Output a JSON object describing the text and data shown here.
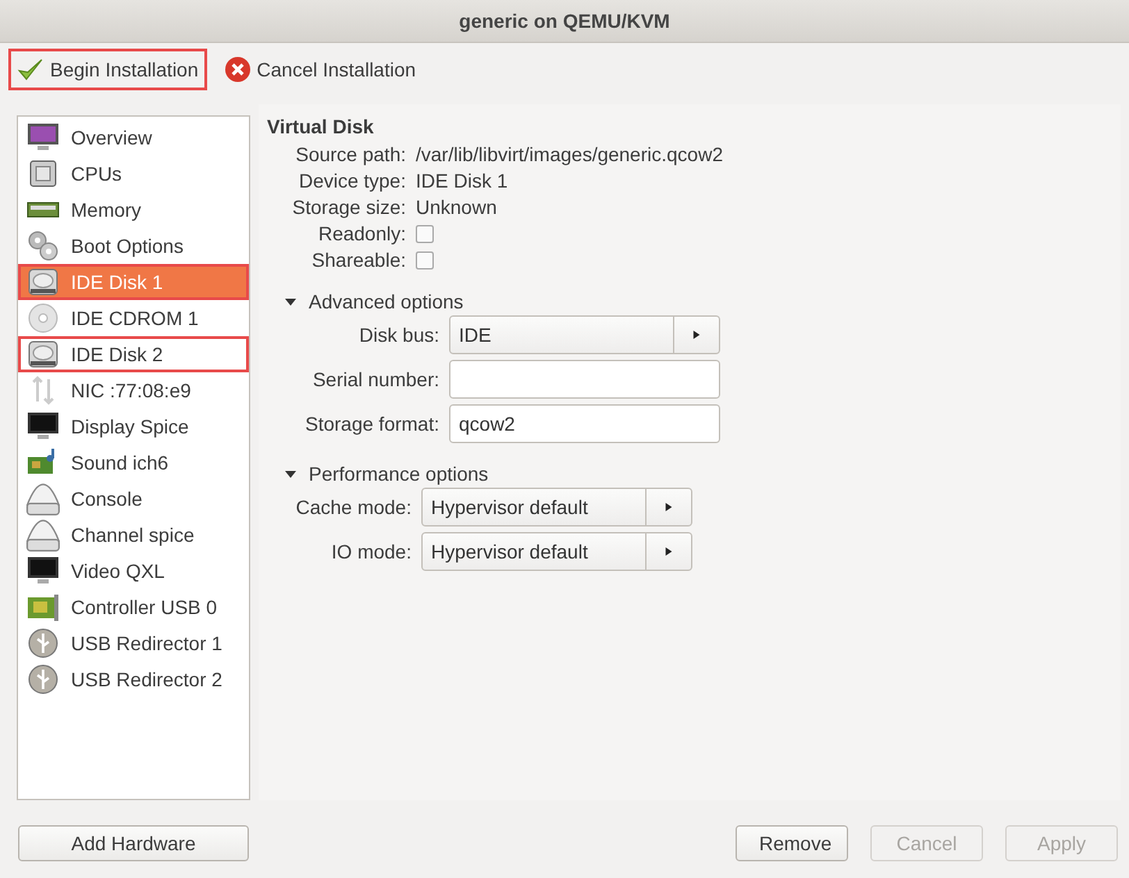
{
  "window": {
    "title": "generic on QEMU/KVM"
  },
  "toolbar": [
    {
      "label": "Begin Installation",
      "kind": "begin",
      "highlighted": true
    },
    {
      "label": "Cancel Installation",
      "kind": "cancel",
      "highlighted": false
    }
  ],
  "sidebar": {
    "items": [
      {
        "label": "Overview",
        "kind": "overview",
        "selected": false,
        "highlighted": false
      },
      {
        "label": "CPUs",
        "kind": "cpu",
        "selected": false,
        "highlighted": false
      },
      {
        "label": "Memory",
        "kind": "memory",
        "selected": false,
        "highlighted": false
      },
      {
        "label": "Boot Options",
        "kind": "boot",
        "selected": false,
        "highlighted": false
      },
      {
        "label": "IDE Disk 1",
        "kind": "disk",
        "selected": true,
        "highlighted": true
      },
      {
        "label": "IDE CDROM 1",
        "kind": "cdrom",
        "selected": false,
        "highlighted": false
      },
      {
        "label": "IDE Disk 2",
        "kind": "disk",
        "selected": false,
        "highlighted": true
      },
      {
        "label": "NIC :77:08:e9",
        "kind": "nic",
        "selected": false,
        "highlighted": false
      },
      {
        "label": "Display Spice",
        "kind": "display",
        "selected": false,
        "highlighted": false
      },
      {
        "label": "Sound ich6",
        "kind": "sound",
        "selected": false,
        "highlighted": false
      },
      {
        "label": "Console",
        "kind": "console",
        "selected": false,
        "highlighted": false
      },
      {
        "label": "Channel spice",
        "kind": "console",
        "selected": false,
        "highlighted": false
      },
      {
        "label": "Video QXL",
        "kind": "display",
        "selected": false,
        "highlighted": false
      },
      {
        "label": "Controller USB 0",
        "kind": "controller",
        "selected": false,
        "highlighted": false
      },
      {
        "label": "USB Redirector 1",
        "kind": "usb",
        "selected": false,
        "highlighted": false
      },
      {
        "label": "USB Redirector 2",
        "kind": "usb",
        "selected": false,
        "highlighted": false
      }
    ]
  },
  "details": {
    "title": "Virtual Disk",
    "info": [
      {
        "label": "Source path:",
        "value": "/var/lib/libvirt/images/generic.qcow2"
      },
      {
        "label": "Device type:",
        "value": "IDE Disk 1"
      },
      {
        "label": "Storage size:",
        "value": "Unknown"
      }
    ],
    "flags": [
      {
        "label": "Readonly:",
        "checked": false
      },
      {
        "label": "Shareable:",
        "checked": false
      }
    ],
    "sections": [
      {
        "title": "Advanced options",
        "expanded": true,
        "fields": [
          {
            "label": "Disk bus:",
            "kind": "combo",
            "value": "IDE"
          },
          {
            "label": "Serial number:",
            "kind": "entry"
          },
          {
            "label": "Storage format:",
            "kind": "entry",
            "value": "qcow2"
          }
        ]
      },
      {
        "title": "Performance options",
        "expanded": true,
        "fields": [
          {
            "label": "Cache mode:",
            "kind": "combo",
            "value": "Hypervisor default"
          },
          {
            "label": "IO mode:",
            "kind": "combo",
            "value": "Hypervisor default"
          }
        ]
      }
    ]
  },
  "add_button": "Add Hardware",
  "buttons": [
    {
      "label": "Remove",
      "disabled": false
    },
    {
      "label": "Cancel",
      "disabled": true
    },
    {
      "label": "Apply",
      "disabled": true
    }
  ]
}
